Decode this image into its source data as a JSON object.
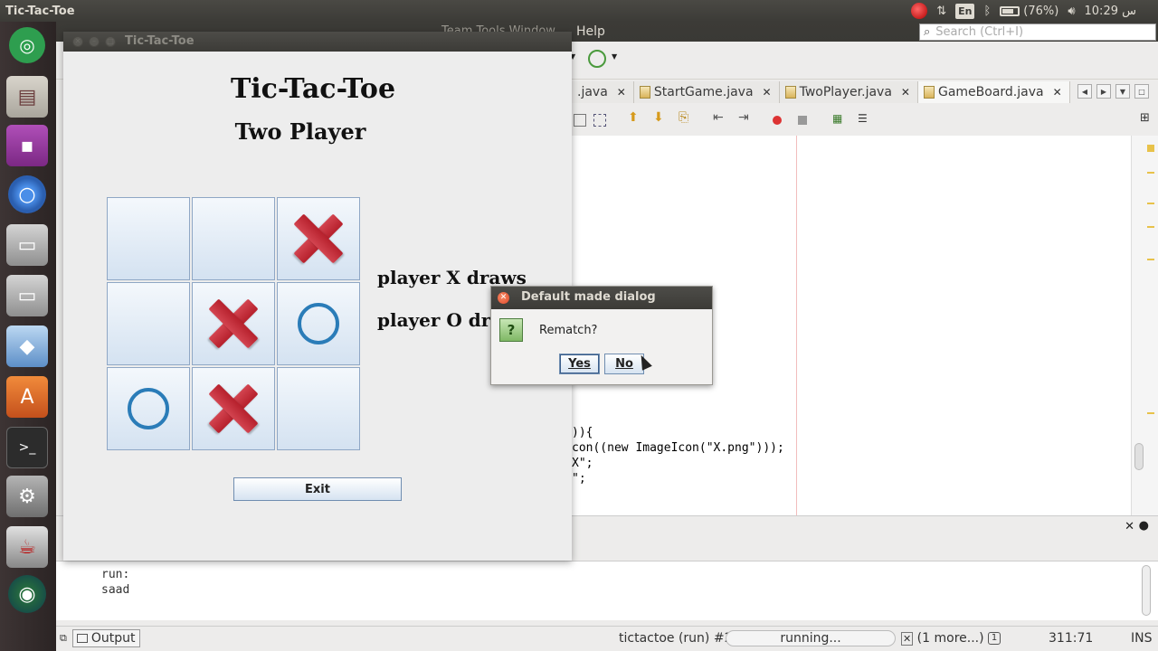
{
  "topbar": {
    "active_app": "Tic-Tac-Toe",
    "keyboard_layout": "En",
    "battery": "(76%)",
    "clock": "10:29 س"
  },
  "ide": {
    "menu_partial": "Team  Tools  Window",
    "menu_help": "Help",
    "search_placeholder": "Search (Ctrl+I)",
    "tabs": [
      {
        "label": ".java",
        "active": false
      },
      {
        "label": "StartGame.java",
        "active": false
      },
      {
        "label": "TwoPlayer.java",
        "active": false
      },
      {
        "label": "GameBoard.java",
        "active": true
      }
    ],
    "code_lines": [
      ")){",
      "con((new ImageIcon(\"X.png\")));",
      "X\";",
      "\";"
    ],
    "output": {
      "lines": [
        "run:",
        "saad"
      ],
      "tab_label": "Output"
    },
    "status": {
      "task": "tictactoe (run) #2",
      "progress_label": "running...",
      "more": "(1 more...)",
      "position": "311:71",
      "mode": "INS"
    }
  },
  "game": {
    "window_title": "Tic-Tac-Toe",
    "title": "Tic-Tac-Toe",
    "subtitle": "Two Player",
    "board": [
      [
        "",
        "",
        "X"
      ],
      [
        "",
        "X",
        "O"
      ],
      [
        "O",
        "X",
        ""
      ]
    ],
    "status_x": "player X draws",
    "status_o": "player O draws",
    "exit_label": "Exit"
  },
  "dialog": {
    "title": "Default made dialog",
    "icon": "question-icon",
    "message": "Rematch?",
    "yes_label": "Yes",
    "no_label": "No"
  },
  "colors": {
    "x_mark": "#c2303c",
    "o_mark": "#2a7cb8",
    "panel": "#3c3b37"
  }
}
